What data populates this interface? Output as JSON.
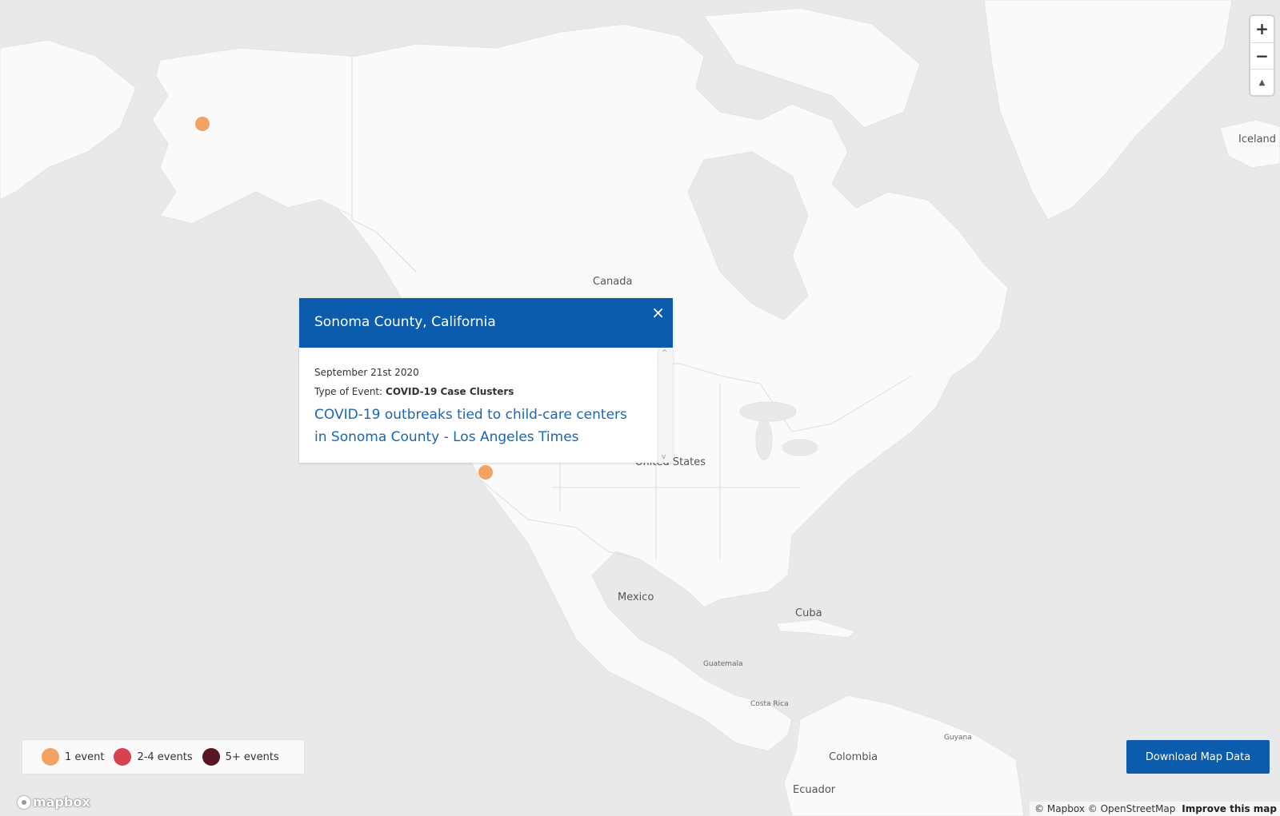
{
  "map": {
    "labels": [
      {
        "key": "canada",
        "text": "Canada"
      },
      {
        "key": "united-states",
        "text": "United States"
      },
      {
        "key": "mexico",
        "text": "Mexico"
      },
      {
        "key": "cuba",
        "text": "Cuba"
      },
      {
        "key": "guatemala",
        "text": "Guatemala"
      },
      {
        "key": "costa-rica",
        "text": "Costa Rica"
      },
      {
        "key": "colombia",
        "text": "Colombia"
      },
      {
        "key": "ecuador",
        "text": "Ecuador"
      },
      {
        "key": "guyana",
        "text": "Guyana"
      },
      {
        "key": "iceland",
        "text": "Iceland"
      }
    ],
    "markers": [
      {
        "key": "alaska",
        "category": "1 event",
        "color": "#f4a261"
      },
      {
        "key": "sonoma",
        "category": "1 event",
        "color": "#f4a261"
      }
    ]
  },
  "zoom": {
    "zoom_in": "+",
    "zoom_out": "−",
    "compass": "▲"
  },
  "popup": {
    "title": "Sonoma County, California",
    "close": "×",
    "date": "September 21st 2020",
    "type_label": "Type of Event:",
    "type_value": "COVID-19 Case Clusters",
    "link_text": "COVID-19 outbreaks tied to child-care centers in Sonoma County - Los Angeles Times"
  },
  "legend": {
    "items": [
      {
        "label": "1 event",
        "color": "#f4a261"
      },
      {
        "label": "2-4 events",
        "color": "#d8414f"
      },
      {
        "label": "5+ events",
        "color": "#5a1522"
      }
    ]
  },
  "download_button": "Download Map Data",
  "logo_text": "mapbox",
  "attribution": {
    "text": "© Mapbox © OpenStreetMap",
    "improve_link": "Improve this map"
  },
  "colors": {
    "water": "#e9e9e9",
    "land": "#fafafa",
    "accent": "#0b5cad",
    "link": "#1a66b3"
  }
}
